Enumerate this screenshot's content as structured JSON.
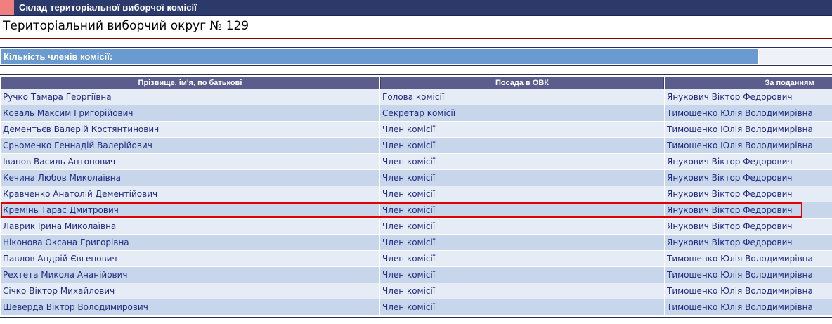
{
  "header": {
    "title": "Склад територіальної виборчої комісії"
  },
  "district": {
    "title": "Територіальний виборчий округ № 129"
  },
  "count": {
    "label": "Кількість членів комісії:",
    "value": ""
  },
  "table": {
    "columns": [
      "Прізвище, ім'я, по батькові",
      "Посада в ОВК",
      "За поданням"
    ],
    "rows": [
      {
        "name": "Ручко Тамара Георгіївна",
        "position": "Голова комісії",
        "nominated_by": "Янукович Віктор Федорович"
      },
      {
        "name": "Коваль Максим Григорійович",
        "position": "Секретар комісії",
        "nominated_by": "Тимошенко Юлія Володимирівна"
      },
      {
        "name": "Дементьєв Валерій Костянтинович",
        "position": "Член комісії",
        "nominated_by": "Тимошенко Юлія Володимирівна"
      },
      {
        "name": "Єрьоменко Геннадій Валерійович",
        "position": "Член комісії",
        "nominated_by": "Тимошенко Юлія Володимирівна"
      },
      {
        "name": "Іванов Василь Антонович",
        "position": "Член комісії",
        "nominated_by": "Янукович Віктор Федорович"
      },
      {
        "name": "Кечина Любов Миколаївна",
        "position": "Член комісії",
        "nominated_by": "Янукович Віктор Федорович"
      },
      {
        "name": "Кравченко Анатолій Дементійович",
        "position": "Член комісії",
        "nominated_by": "Янукович Віктор Федорович"
      },
      {
        "name": "Кремінь Тарас Дмитрович",
        "position": "Член комісії",
        "nominated_by": "Янукович Віктор Федорович"
      },
      {
        "name": "Лаврик Ірина Миколаївна",
        "position": "Член комісії",
        "nominated_by": "Янукович Віктор Федорович"
      },
      {
        "name": "Ніконова Оксана Григорівна",
        "position": "Член комісії",
        "nominated_by": "Янукович Віктор Федорович"
      },
      {
        "name": "Павлов Андрій Євгенович",
        "position": "Член комісії",
        "nominated_by": "Тимошенко Юлія Володимирівна"
      },
      {
        "name": "Рехтета Микола Ананійович",
        "position": "Член комісії",
        "nominated_by": "Тимошенко Юлія Володимирівна"
      },
      {
        "name": "Січко Віктор Михайлович",
        "position": "Член комісії",
        "nominated_by": "Тимошенко Юлія Володимирівна"
      },
      {
        "name": "Шеверда Віктор Володимирович",
        "position": "Член комісії",
        "nominated_by": "Тимошенко Юлія Володимирівна"
      }
    ],
    "highlighted_row": 7
  },
  "colors": {
    "header_bg": "#2c3a6b",
    "accent": "#f08080",
    "count_bar": "#6a9bd0",
    "column_header_bg": "#5b5d8c",
    "row_odd": "#e6ecf5",
    "row_even": "#c7d6ea",
    "text": "#1f2a80",
    "highlight": "#e00000"
  }
}
